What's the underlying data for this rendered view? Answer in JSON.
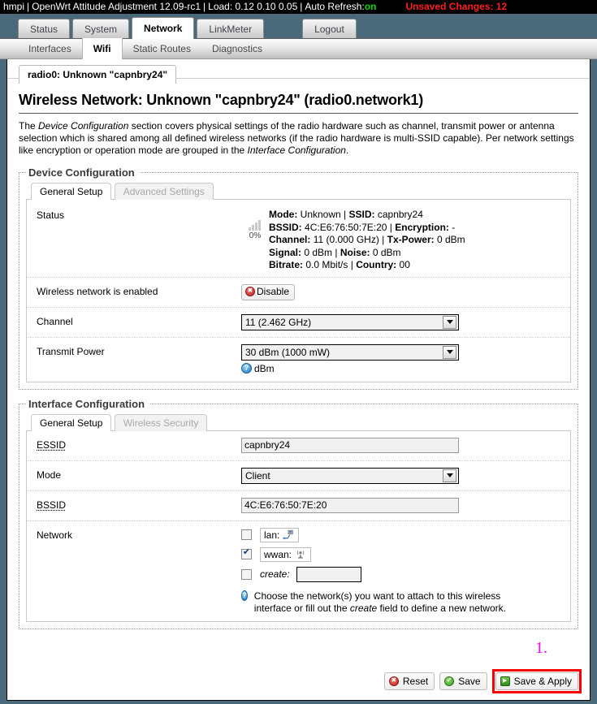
{
  "header": {
    "hostname": "hmpi",
    "firmware": "OpenWrt Attitude Adjustment 12.09-rc1",
    "load": "Load: 0.12 0.10 0.05",
    "auto_refresh_label": "Auto Refresh:",
    "auto_refresh_value": "on",
    "unsaved_changes": "Unsaved Changes: 12",
    "sep": "|"
  },
  "nav": {
    "primary": [
      {
        "label": "Status",
        "active": false
      },
      {
        "label": "System",
        "active": false
      },
      {
        "label": "Network",
        "active": true
      },
      {
        "label": "LinkMeter",
        "active": false
      },
      {
        "label": "Logout",
        "active": false
      }
    ],
    "secondary": [
      {
        "label": "Interfaces",
        "active": false
      },
      {
        "label": "Wifi",
        "active": true
      },
      {
        "label": "Static Routes",
        "active": false
      },
      {
        "label": "Diagnostics",
        "active": false
      }
    ],
    "tertiary": [
      {
        "label": "radio0: Unknown \"capnbry24\"",
        "active": true
      }
    ]
  },
  "page": {
    "title": "Wireless Network: Unknown \"capnbry24\" (radio0.network1)",
    "desc_part1": "The ",
    "desc_em1": "Device Configuration",
    "desc_part2": " section covers physical settings of the radio hardware such as channel, transmit power or antenna selection which is shared among all defined wireless networks (if the radio hardware is multi-SSID capable). Per network settings like encryption or operation mode are grouped in the ",
    "desc_em2": "Interface Configuration",
    "desc_part3": "."
  },
  "device_config": {
    "legend": "Device Configuration",
    "tabs": [
      {
        "label": "General Setup",
        "active": true
      },
      {
        "label": "Advanced Settings",
        "active": false
      }
    ],
    "status": {
      "label": "Status",
      "signal_percent": "0%",
      "lines": [
        {
          "pairs": [
            {
              "k": "Mode:",
              "v": "Unknown"
            },
            {
              "k": "SSID:",
              "v": "capnbry24"
            }
          ]
        },
        {
          "pairs": [
            {
              "k": "BSSID:",
              "v": "4C:E6:76:50:7E:20"
            },
            {
              "k": "Encryption:",
              "v": "-"
            }
          ]
        },
        {
          "pairs": [
            {
              "k": "Channel:",
              "v": "11 (0.000 GHz)"
            },
            {
              "k": "Tx-Power:",
              "v": "0 dBm"
            }
          ]
        },
        {
          "pairs": [
            {
              "k": "Signal:",
              "v": "0 dBm"
            },
            {
              "k": "Noise:",
              "v": "0 dBm"
            }
          ]
        },
        {
          "pairs": [
            {
              "k": "Bitrate:",
              "v": "0.0 Mbit/s"
            },
            {
              "k": "Country:",
              "v": "00"
            }
          ]
        }
      ]
    },
    "enabled_row": {
      "label": "Wireless network is enabled",
      "button": "Disable"
    },
    "channel_row": {
      "label": "Channel",
      "value": "11 (2.462 GHz)"
    },
    "txpower_row": {
      "label": "Transmit Power",
      "value": "30 dBm (1000 mW)",
      "help": "dBm"
    }
  },
  "interface_config": {
    "legend": "Interface Configuration",
    "tabs": [
      {
        "label": "General Setup",
        "active": true
      },
      {
        "label": "Wireless Security",
        "active": false
      }
    ],
    "essid_row": {
      "label": "ESSID",
      "value": "capnbry24"
    },
    "mode_row": {
      "label": "Mode",
      "value": "Client"
    },
    "bssid_row": {
      "label": "BSSID",
      "value": "4C:E6:76:50:7E:20"
    },
    "network_row": {
      "label": "Network",
      "options": [
        {
          "label": "lan:",
          "icon": "ethernet-icon",
          "checked": false
        },
        {
          "label": "wwan:",
          "icon": "wifi-antenna-icon",
          "checked": true
        }
      ],
      "create_label": "create:",
      "create_value": "",
      "create_checked": false,
      "help_part1": "Choose the network(s) you want to attach to this wireless interface or fill out the ",
      "help_em": "create",
      "help_part2": " field to define a new network."
    }
  },
  "actions": {
    "reset": "Reset",
    "save": "Save",
    "save_apply": "Save & Apply"
  },
  "annotations": {
    "step1": "1."
  },
  "colors": {
    "page_background": "#4a6a7b",
    "header_background": "#000000",
    "auto_refresh_on": "#00d900",
    "unsaved_changes": "#ff1e1e",
    "highlight_box": "#ff0000",
    "annotation": "#ff00ff"
  }
}
